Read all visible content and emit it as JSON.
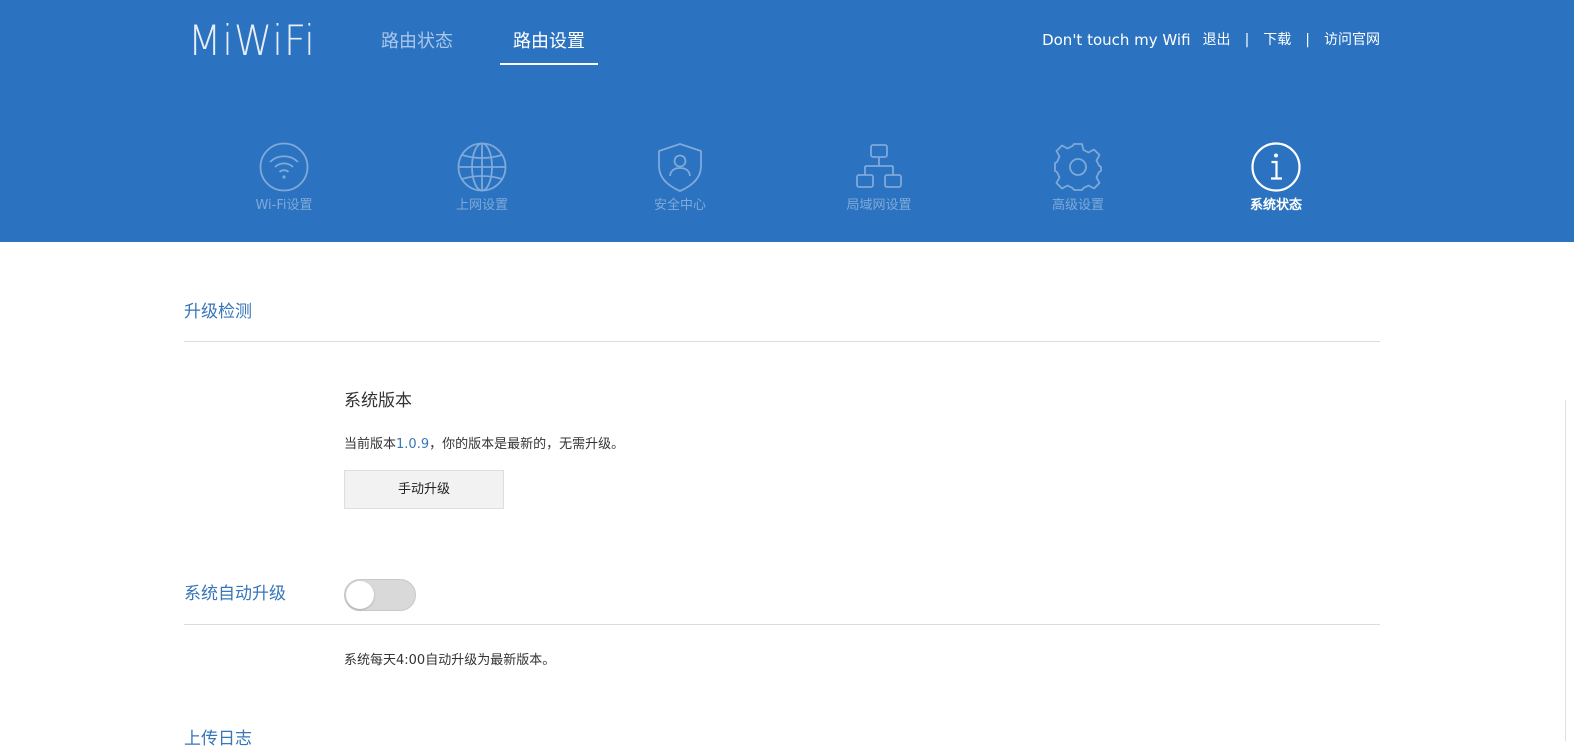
{
  "header": {
    "logo": "MiWiFi",
    "tabs": [
      {
        "label": "路由状态",
        "active": false
      },
      {
        "label": "路由设置",
        "active": true
      }
    ],
    "user_name": "Don't touch my Wifi",
    "logout": "退出",
    "separator": "|",
    "download": "下载",
    "official_site": "访问官网"
  },
  "nav": {
    "items": [
      {
        "label": "Wi-Fi设置",
        "icon": "wifi-icon",
        "active": false
      },
      {
        "label": "上网设置",
        "icon": "globe-icon",
        "active": false
      },
      {
        "label": "安全中心",
        "icon": "shield-icon",
        "active": false
      },
      {
        "label": "局域网设置",
        "icon": "lan-icon",
        "active": false
      },
      {
        "label": "高级设置",
        "icon": "gear-icon",
        "active": false
      },
      {
        "label": "系统状态",
        "icon": "info-icon",
        "active": true
      }
    ]
  },
  "upgrade": {
    "section_title": "升级检测",
    "sub_title": "系统版本",
    "version_prefix": "当前版本",
    "version": "1.0.9",
    "version_suffix": "，你的版本是最新的，无需升级。",
    "manual_upgrade_button": "手动升级"
  },
  "auto_upgrade": {
    "section_title": "系统自动升级",
    "enabled": false,
    "description": "系统每天4:00自动升级为最新版本。"
  },
  "next_section": {
    "title": "上传日志"
  },
  "colors": {
    "header_bg": "#2b73c0",
    "accent": "#3776b8",
    "nav_inactive": "#7fa9d9"
  }
}
